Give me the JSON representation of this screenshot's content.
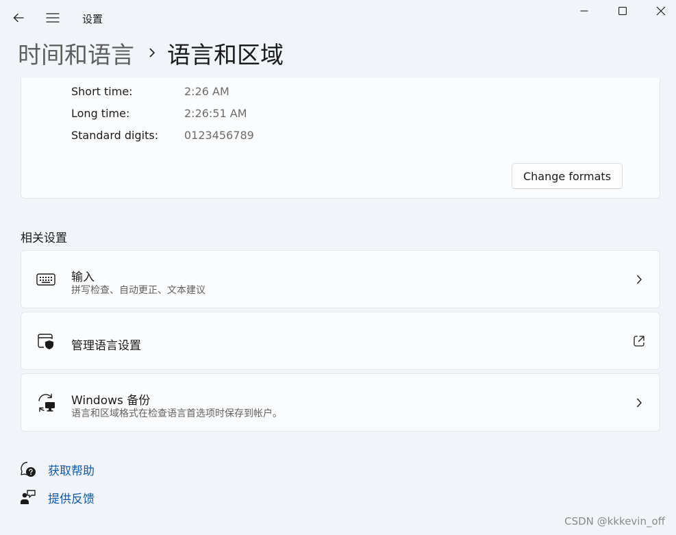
{
  "window": {
    "app_title": "设置",
    "back_icon": "back-arrow-icon",
    "menu_icon": "hamburger-menu-icon"
  },
  "breadcrumb": {
    "parent": "时间和语言",
    "current": "语言和区域"
  },
  "formats": {
    "rows": [
      {
        "label": "Short time:",
        "value": "2:26 AM"
      },
      {
        "label": "Long time:",
        "value": "2:26:51 AM"
      },
      {
        "label": "Standard digits:",
        "value": "0123456789"
      }
    ],
    "change_button": "Change formats"
  },
  "related": {
    "title": "相关设置",
    "items": [
      {
        "title": "输入",
        "subtitle": "拼写检查、自动更正、文本建议",
        "icon": "keyboard-icon",
        "trailing": "chevron-right-icon"
      },
      {
        "title": "管理语言设置",
        "subtitle": "",
        "icon": "admin-shield-window-icon",
        "trailing": "open-external-icon"
      },
      {
        "title": "Windows 备份",
        "subtitle": "语言和区域格式在检查语言首选项时保存到帐户。",
        "icon": "sync-backup-icon",
        "trailing": "chevron-right-icon"
      }
    ]
  },
  "links": [
    {
      "label": "获取帮助",
      "icon": "help-chat-icon"
    },
    {
      "label": "提供反馈",
      "icon": "feedback-person-icon"
    }
  ],
  "watermark": "CSDN @kkkevin_off",
  "colors": {
    "background": "#f1f4f9",
    "card": "#fbfcfd",
    "link": "#0f5ba8",
    "secondary_text": "#6b6b6b"
  }
}
